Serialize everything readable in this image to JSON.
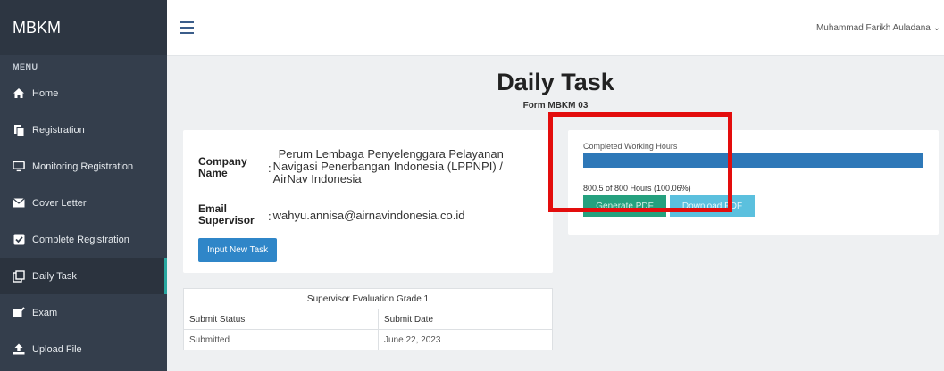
{
  "brand": "MBKM",
  "sidebar": {
    "menu_title": "MENU",
    "items": [
      {
        "label": "Home",
        "icon": "home-icon"
      },
      {
        "label": "Registration",
        "icon": "copy-icon"
      },
      {
        "label": "Monitoring Registration",
        "icon": "monitor-icon"
      },
      {
        "label": "Cover Letter",
        "icon": "envelope-icon"
      },
      {
        "label": "Complete Registration",
        "icon": "check-square-icon"
      },
      {
        "label": "Daily Task",
        "icon": "tasks-icon",
        "active": true
      },
      {
        "label": "Exam",
        "icon": "edit-icon"
      },
      {
        "label": "Upload File",
        "icon": "upload-icon"
      }
    ]
  },
  "topbar": {
    "user_name": "Muhammad Farikh Auladana",
    "user_caret": "⌄"
  },
  "main": {
    "title": "Daily Task",
    "subtitle": "Form MBKM 03",
    "company": {
      "label_line1": "Company",
      "label_line2": "Name",
      "value_line1": "Perum Lembaga Penyelenggara Pelayanan",
      "value_line2": "Navigasi Penerbangan Indonesia (LPPNPI) /",
      "value_line3": "AirNav Indonesia"
    },
    "email": {
      "label_line1": "Email",
      "label_line2": "Supervisor",
      "value": "wahyu.annisa@airnavindonesia.co.id"
    },
    "colon": ":",
    "input_task_button": "Input New Task",
    "working_hours": {
      "label": "Completed Working Hours",
      "progress_percent": 100,
      "text": "800.5 of 800 Hours (100.06%)",
      "generate_button": "Generate PDF",
      "download_button": "Download PDF"
    },
    "evaluation": {
      "caption": "Supervisor Evaluation Grade 1",
      "headers": [
        "Submit Status",
        "Submit Date"
      ],
      "row": [
        "Submitted",
        "June 22, 2023"
      ]
    }
  },
  "colors": {
    "sidebar_bg": "#343e4c",
    "primary": "#2f86c8",
    "progress": "#2e78b8",
    "success": "#25a17f",
    "info": "#5bc0de",
    "highlight": "#e30d0d",
    "active_indicator": "#28a7a0"
  }
}
